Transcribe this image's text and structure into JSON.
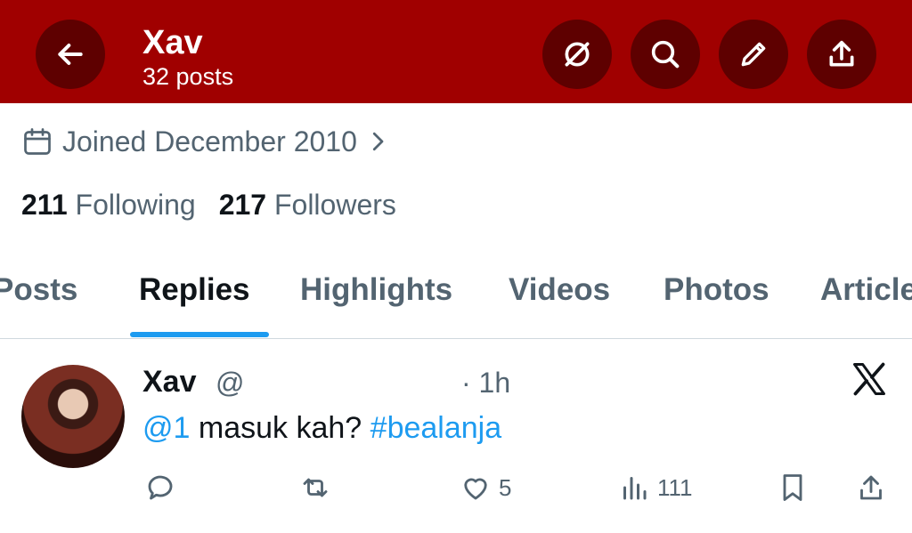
{
  "header": {
    "title": "Xav",
    "subtitle": "32 posts",
    "bg_color": "#a00000",
    "icons": [
      "back-arrow-icon",
      "grok-icon",
      "search-icon",
      "edit-icon",
      "share-icon"
    ]
  },
  "profile": {
    "joined": "Joined December 2010",
    "following_count": "211",
    "following_label": "Following",
    "followers_count": "217",
    "followers_label": "Followers"
  },
  "tabs": [
    {
      "label": "Posts"
    },
    {
      "label": "Replies"
    },
    {
      "label": "Highlights"
    },
    {
      "label": "Videos"
    },
    {
      "label": "Photos"
    },
    {
      "label": "Articles"
    }
  ],
  "tweet": {
    "name": "Xav",
    "handle": "@",
    "time": "· 1h",
    "mention": "@1",
    "text": " masuk kah? ",
    "hashtag": "#bealanja",
    "likes": "5",
    "views": "111"
  },
  "accent_color": "#1d9bf0"
}
